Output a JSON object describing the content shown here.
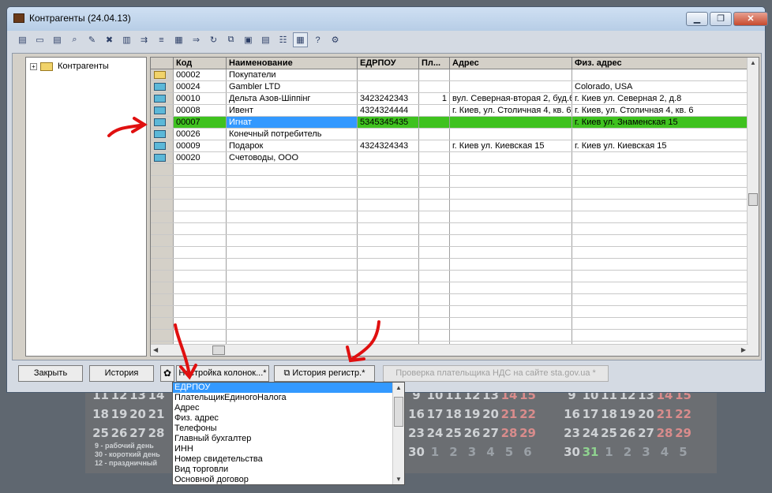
{
  "window": {
    "title": "Контрагенты (24.04.13)",
    "minimize": "▁",
    "maximize": "❐",
    "close": "✕"
  },
  "toolbar": {
    "icons": [
      "new-record-icon",
      "new-folder-icon",
      "copy-record-icon",
      "find-icon",
      "edit-record-icon",
      "delete-record-icon",
      "print-icon",
      "move-icon",
      "sort-icon",
      "group-icon",
      "filter-icon",
      "refresh-icon",
      "copy-icon",
      "properties-icon",
      "report-icon",
      "hierarchy-icon",
      "view-icon",
      "help-icon",
      "settings-icon"
    ],
    "glyphs": [
      "▤",
      "▭",
      "▤",
      "⌕",
      "✎",
      "✖",
      "▥",
      "⇉",
      "≡",
      "▦",
      "⇒",
      "↻",
      "⧉",
      "▣",
      "▤",
      "☷",
      "▦",
      "?",
      "⚙"
    ]
  },
  "tree": {
    "expander": "+",
    "root_label": "Контрагенты"
  },
  "grid": {
    "headers": [
      "",
      "Код",
      "Наименование",
      "ЕДРПОУ",
      "Пл...",
      "Адрес",
      "Физ. адрес"
    ],
    "rows": [
      {
        "folder": "yellow",
        "code": "00002",
        "name": "Покупатели",
        "edrpou": "",
        "pl": "",
        "address": "",
        "phys": ""
      },
      {
        "folder": "blue",
        "code": "00024",
        "name": "Gambler LTD",
        "edrpou": "",
        "pl": "",
        "address": "",
        "phys": "Colorado, USA"
      },
      {
        "folder": "blue",
        "code": "00010",
        "name": "Дельта Азов-Шіппінг",
        "edrpou": "3423242343",
        "pl": "1",
        "address": "вул. Северная-вторая 2, буд.6",
        "phys": "г. Киев ул. Северная 2, д.8"
      },
      {
        "folder": "blue",
        "code": "00008",
        "name": "Ивент",
        "edrpou": "4324324444",
        "pl": "",
        "address": "г. Киев, ул. Столичная 4, кв. 6",
        "phys": "г. Киев, ул. Столичная 4, кв. 6"
      },
      {
        "folder": "blue",
        "code": "00007",
        "name": "Игнат",
        "edrpou": "5345345435",
        "pl": "",
        "address": "",
        "phys": "г. Киев ул. Знаменская 15",
        "selected": true
      },
      {
        "folder": "blue",
        "code": "00026",
        "name": "Конечный потребитель",
        "edrpou": "",
        "pl": "",
        "address": "",
        "phys": ""
      },
      {
        "folder": "blue",
        "code": "00009",
        "name": "Подарок",
        "edrpou": "4324324343",
        "pl": "",
        "address": "г. Киев ул. Киевская 15",
        "phys": "г. Киев ул. Киевская 15"
      },
      {
        "folder": "blue",
        "code": "00020",
        "name": "Счетоводы, ООО",
        "edrpou": "",
        "pl": "",
        "address": "",
        "phys": ""
      }
    ]
  },
  "buttons": {
    "close": "Закрыть",
    "history": "История",
    "columns": "Настройка колонок...*",
    "reg_history": "История регистр.*",
    "vat_check": "Проверка плательщика НДС на сайте sta.gov.ua *"
  },
  "dropdown": {
    "items": [
      "ЕДРПОУ",
      "ПлательщикЕдиногоНалога",
      "Адрес",
      "Физ. адрес",
      "Телефоны",
      "Главный бухгалтер",
      "ИНН",
      "Номер свидетельства",
      "Вид торговли",
      "Основной договор"
    ],
    "selected_index": 0
  },
  "calendar": {
    "rows": [
      [
        "11",
        "12",
        "13",
        "14",
        "",
        "",
        "",
        "",
        "",
        "",
        "",
        "",
        "",
        "",
        "",
        "",
        "",
        "9",
        "10",
        "11",
        "12",
        "13",
        "14",
        "15"
      ],
      [
        "18",
        "19",
        "20",
        "21",
        "",
        "",
        "",
        "",
        "",
        "",
        "",
        "",
        "",
        "",
        "",
        "",
        "",
        "16",
        "17",
        "18",
        "19",
        "20",
        "21",
        "22"
      ],
      [
        "25",
        "26",
        "27",
        "28",
        "",
        "",
        "",
        "",
        "",
        "",
        "",
        "",
        "",
        "",
        "",
        "",
        "",
        "23",
        "24",
        "25",
        "26",
        "27",
        "28",
        "29"
      ],
      [
        "",
        "",
        "",
        "",
        "",
        "",
        "",
        "",
        "",
        "",
        "",
        "",
        "",
        "",
        "",
        "",
        "",
        "30",
        "1",
        "2",
        "3",
        "4",
        "5",
        "6"
      ]
    ],
    "legend": [
      "9 - рабочий день",
      "30 - короткий день",
      "12 - праздничный"
    ]
  }
}
